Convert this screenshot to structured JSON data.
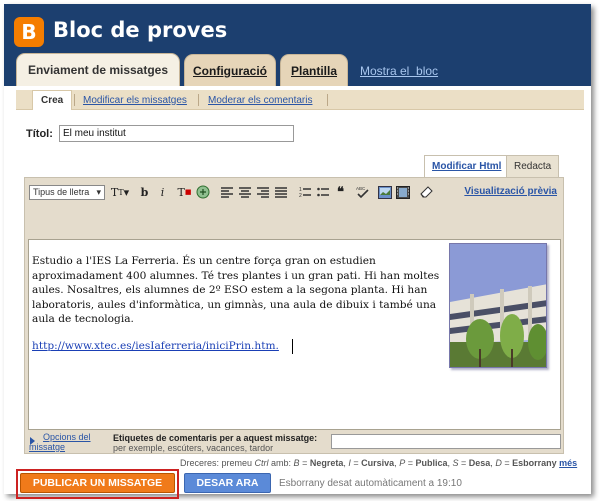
{
  "blog": {
    "title": "Bloc de proves",
    "logo_letter": "B"
  },
  "colors": {
    "header": "#1c3f6f",
    "accent": "#f07a1a",
    "tab": "#e6d5b8"
  },
  "tabs": [
    {
      "label": "Enviament de missatges",
      "active": true
    },
    {
      "label": "Configuració",
      "active": false
    },
    {
      "label": "Plantilla",
      "active": false
    }
  ],
  "header_link": "Mostra el  bloc",
  "subtabs": [
    {
      "label": "Crea",
      "active": true
    },
    {
      "label": "Modificar els missatges",
      "active": false
    },
    {
      "label": "Moderar els comentaris",
      "active": false
    }
  ],
  "post": {
    "title_label": "Títol:",
    "title_value": "El meu institut",
    "body": "Estudio a l'IES La Ferreria. És un centre força gran on estudien aproximadament 400 alumnes. Té tres plantes i un gran pati. Hi han moltes aules. Nosaltres, els alumnes de 2º ESO estem a la segona planta. Hi han laboratoris, aules d'informàtica, un gimnàs, una aula de dibuix i també una aula de tecnologia.",
    "url": "http://www.xtec.es/iesIaferreria/iniciPrin.htm."
  },
  "editor": {
    "tab_html": "Modificar Html",
    "tab_compose": "Redacta",
    "font_select": "Tipus de lletra",
    "preview": "Visualització prèvia",
    "toolbar_icons": [
      "font-size-icon",
      "bold-icon",
      "italic-icon",
      "text-color-icon",
      "link-icon",
      "align-left-icon",
      "align-center-icon",
      "align-right-icon",
      "align-justify-icon",
      "numbered-list-icon",
      "bullet-list-icon",
      "blockquote-icon",
      "spellcheck-icon",
      "image-icon",
      "video-icon",
      "remove-format-icon"
    ]
  },
  "options": {
    "post_options": "Opcions del missatge",
    "labels_title": "Etiquetes de comentaris per a aquest missatge:",
    "labels_hint": "per exemple, escúters, vacances, tardor"
  },
  "shortcuts": {
    "prefix": "Dreceres: premeu ",
    "ctrl": "Ctrl",
    "mid": " amb: ",
    "items": [
      {
        "key": "B",
        "label": "Negreta"
      },
      {
        "key": "I",
        "label": "Cursiva"
      },
      {
        "key": "P",
        "label": "Publica"
      },
      {
        "key": "S",
        "label": "Desa"
      },
      {
        "key": "D",
        "label": "Esborrany"
      }
    ],
    "more": "més"
  },
  "actions": {
    "publish": "PUBLICAR UN MISSATGE",
    "save": "DESAR ARA",
    "status": "Esborrany desat automàticament a 19:10"
  }
}
